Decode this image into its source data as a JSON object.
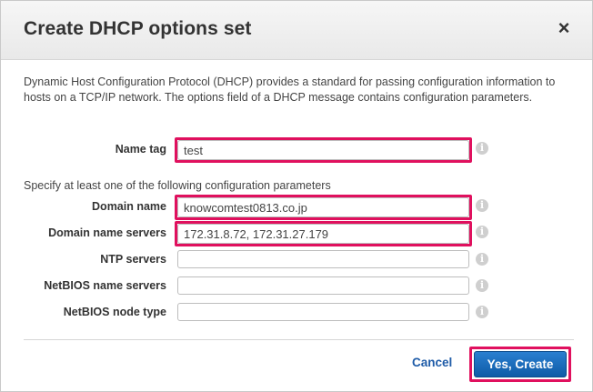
{
  "dialog": {
    "title": "Create DHCP options set",
    "close_glyph": "×",
    "description": "Dynamic Host Configuration Protocol (DHCP) provides a standard for passing configuration information to hosts on a TCP/IP network. The options field of a DHCP message contains configuration parameters.",
    "section_note": "Specify at least one of the following configuration parameters",
    "info_glyph": "i",
    "fields": {
      "name_tag": {
        "label": "Name tag",
        "value": "test"
      },
      "domain_name": {
        "label": "Domain name",
        "value": "knowcomtest0813.co.jp"
      },
      "domain_name_servers": {
        "label": "Domain name servers",
        "value": "172.31.8.72, 172.31.27.179"
      },
      "ntp_servers": {
        "label": "NTP servers",
        "value": ""
      },
      "netbios_name_servers": {
        "label": "NetBIOS name servers",
        "value": ""
      },
      "netbios_node_type": {
        "label": "NetBIOS node type",
        "value": ""
      }
    },
    "footer": {
      "cancel_label": "Cancel",
      "create_label": "Yes, Create"
    }
  },
  "colors": {
    "highlight": "#e0105e",
    "primary_button": "#1a6cc0",
    "link": "#1f5ca8"
  },
  "icons": {
    "close": "close-icon",
    "info": "info-icon"
  }
}
